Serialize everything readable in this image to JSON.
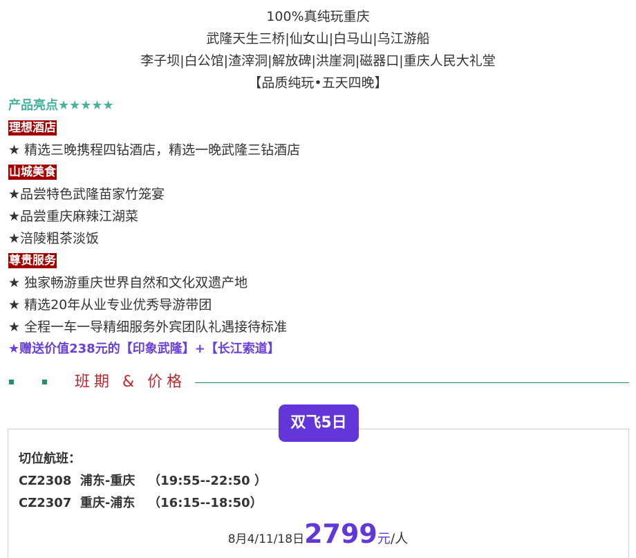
{
  "header": {
    "lines": [
      "100%真纯玩重庆",
      "武隆天生三桥|仙女山|白马山|乌江游船",
      "李子坝|白公馆|渣滓洞|解放碑|洪崖洞|磁器口|重庆人民大礼堂",
      "【品质纯玩•五天四晚】"
    ]
  },
  "highlights": {
    "title": "产品亮点★★★★★",
    "hotel": {
      "tag": "理想酒店",
      "items": [
        "★ 精选三晚携程四钻酒店，精选一晚武隆三钻酒店"
      ]
    },
    "food": {
      "tag": "山城美食",
      "items": [
        "★品尝特色武隆苗家竹笼宴",
        "★品尝重庆麻辣江湖菜",
        "★涪陵粗茶淡饭"
      ]
    },
    "service": {
      "tag": "尊贵服务",
      "items": [
        "★ 独家畅游重庆世界自然和文化双遗产地",
        "★ 精选20年从业专业优秀导游带团",
        "★ 全程一车一导精细服务外宾团队礼遇接待标准"
      ]
    },
    "gift": "★赠送价值238元的【印象武隆】+【长江索道】"
  },
  "section": {
    "title": "班期 & 价格"
  },
  "package": {
    "badge": "双飞5日",
    "flights_label": "切位航班：",
    "flights": [
      "CZ2308  浦东-重庆   （19:55--22:50 ）",
      "CZ2307  重庆-浦东   （16:15--18:50）"
    ],
    "price": {
      "dates": "8月4/11/18日",
      "amount": "2799",
      "unit": "元",
      "per": "/人"
    }
  },
  "colors": {
    "highlight_green": "#45b39d",
    "tag_red": "#a30000",
    "section_red": "#c0272d",
    "accent_purple": "#6236d9",
    "divider_green": "#1f8f72"
  }
}
